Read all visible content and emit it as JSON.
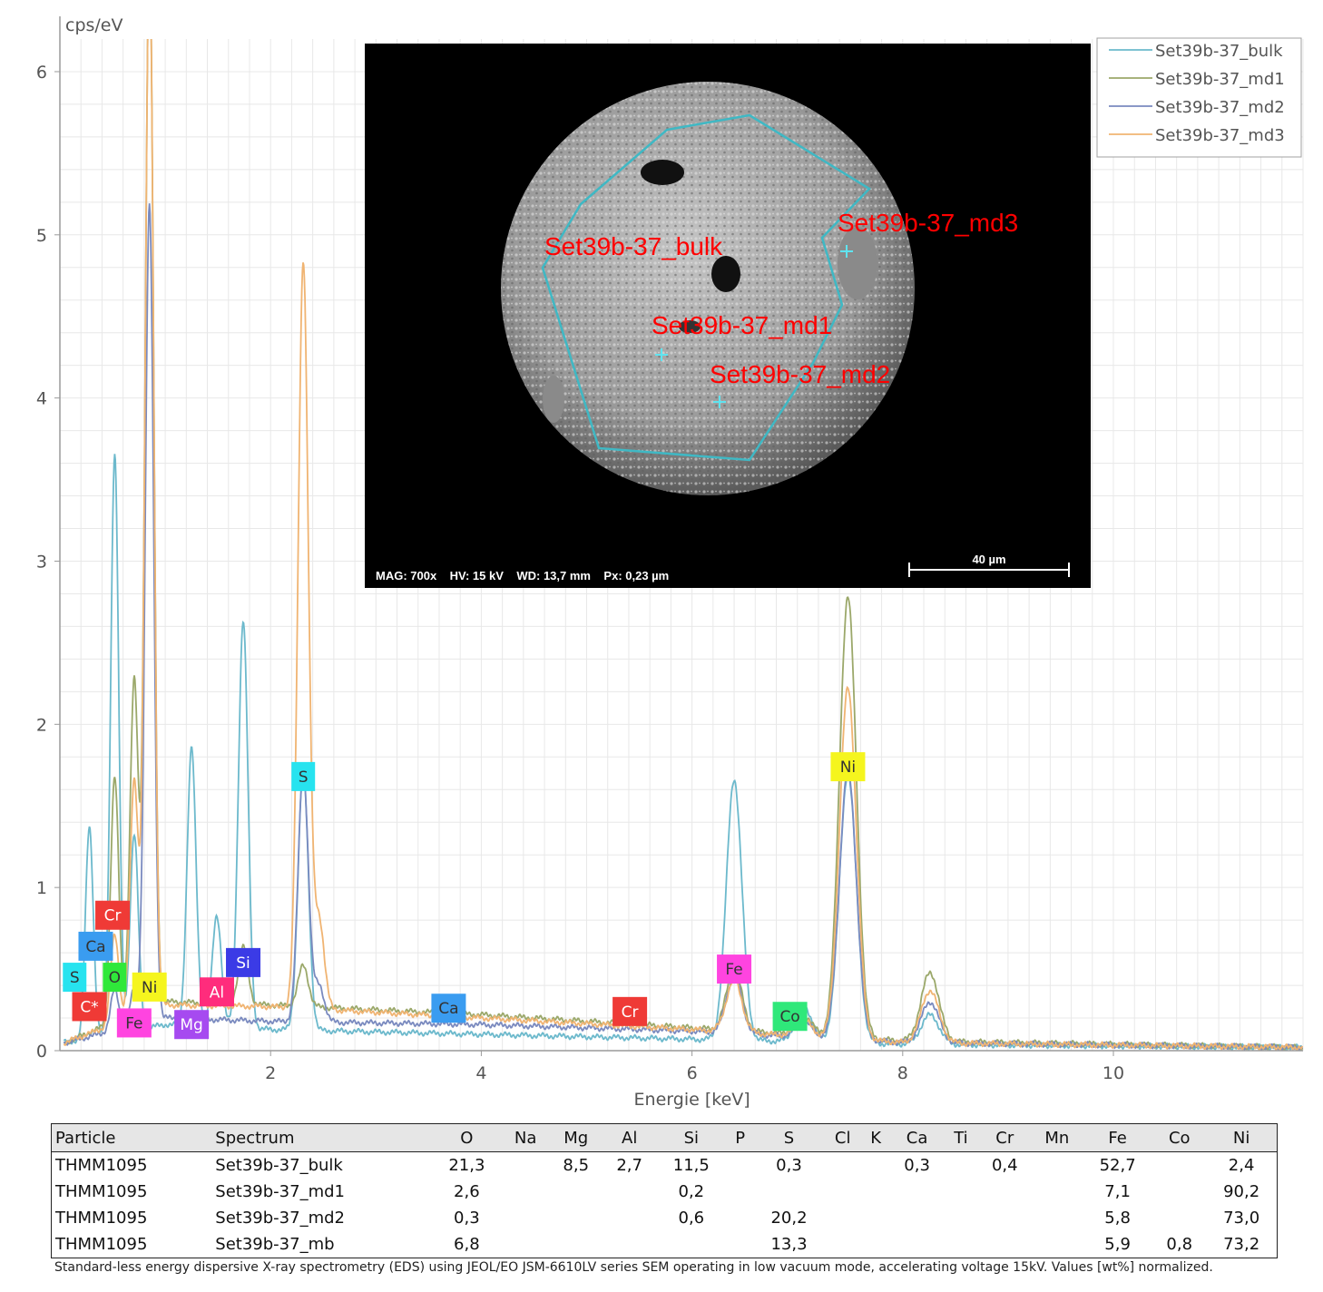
{
  "chart_data": {
    "type": "line",
    "ylabel": "cps/eV",
    "xlabel": "Energie [keV]",
    "xlim": [
      0,
      11.8
    ],
    "ylim": [
      0,
      6.2
    ],
    "xticks": [
      2,
      4,
      6,
      8,
      10
    ],
    "yticks": [
      0,
      1,
      2,
      3,
      4,
      5,
      6
    ],
    "grid": true,
    "legend_position": "top-right",
    "series": [
      {
        "name": "Set39b-37_bulk",
        "color": "#6cb9cc",
        "peaks": [
          [
            0.28,
            1.3
          ],
          [
            0.52,
            3.55
          ],
          [
            0.705,
            1.2
          ],
          [
            1.25,
            1.7
          ],
          [
            1.49,
            0.68
          ],
          [
            1.74,
            2.5
          ],
          [
            2.31,
            1.6
          ],
          [
            6.4,
            1.6
          ],
          [
            7.06,
            0.22
          ],
          [
            7.48,
            1.65
          ],
          [
            8.26,
            0.18
          ]
        ],
        "baseline": [
          [
            0.05,
            0.05
          ],
          [
            1,
            0.16
          ],
          [
            2,
            0.13
          ],
          [
            4,
            0.1
          ],
          [
            6,
            0.07
          ],
          [
            8,
            0.04
          ],
          [
            11.8,
            0.02
          ]
        ]
      },
      {
        "name": "Set39b-37_md1",
        "color": "#9ba86a",
        "peaks": [
          [
            0.52,
            1.5
          ],
          [
            0.705,
            2.05
          ],
          [
            0.85,
            6.5
          ],
          [
            1.74,
            0.35
          ],
          [
            2.31,
            0.25
          ],
          [
            6.4,
            0.38
          ],
          [
            7.06,
            0.12
          ],
          [
            7.48,
            2.7
          ],
          [
            8.26,
            0.42
          ]
        ],
        "baseline": [
          [
            0.05,
            0.05
          ],
          [
            1,
            0.3
          ],
          [
            2,
            0.28
          ],
          [
            4,
            0.22
          ],
          [
            6,
            0.14
          ],
          [
            8,
            0.06
          ],
          [
            11.8,
            0.02
          ]
        ]
      },
      {
        "name": "Set39b-37_md2",
        "color": "#7a8abf",
        "peaks": [
          [
            0.52,
            0.25
          ],
          [
            0.705,
            0.22
          ],
          [
            0.85,
            5.0
          ],
          [
            2.31,
            1.55
          ],
          [
            2.46,
            0.22
          ],
          [
            6.4,
            0.35
          ],
          [
            7.06,
            0.1
          ],
          [
            7.48,
            1.65
          ],
          [
            8.26,
            0.25
          ]
        ],
        "baseline": [
          [
            0.05,
            0.05
          ],
          [
            1,
            0.2
          ],
          [
            2,
            0.18
          ],
          [
            4,
            0.16
          ],
          [
            6,
            0.12
          ],
          [
            8,
            0.05
          ],
          [
            11.8,
            0.02
          ]
        ]
      },
      {
        "name": "Set39b-37_md3",
        "color": "#f0b472",
        "peaks": [
          [
            0.52,
            0.55
          ],
          [
            0.705,
            1.45
          ],
          [
            0.85,
            6.5
          ],
          [
            2.31,
            4.58
          ],
          [
            2.46,
            0.55
          ],
          [
            6.4,
            0.32
          ],
          [
            7.06,
            0.1
          ],
          [
            7.48,
            2.15
          ],
          [
            8.26,
            0.32
          ]
        ],
        "baseline": [
          [
            0.05,
            0.05
          ],
          [
            1,
            0.28
          ],
          [
            2,
            0.27
          ],
          [
            4,
            0.2
          ],
          [
            6,
            0.13
          ],
          [
            8,
            0.05
          ],
          [
            11.8,
            0.02
          ]
        ]
      }
    ],
    "element_labels": [
      {
        "label": "S",
        "color": "#27e3ef",
        "x": 2.31,
        "y": 1.68
      },
      {
        "label": "Ni",
        "color": "#f5f51e",
        "x": 7.48,
        "y": 1.74
      },
      {
        "label": "Fe",
        "color": "#ff44e0",
        "x": 6.4,
        "y": 0.5
      },
      {
        "label": "Co",
        "color": "#2fe87a",
        "x": 6.93,
        "y": 0.21
      },
      {
        "label": "Cr",
        "color": "#ef3a36",
        "x": 5.41,
        "y": 0.24
      },
      {
        "label": "Ca",
        "color": "#3a9cf0",
        "x": 3.69,
        "y": 0.26
      },
      {
        "label": "Si",
        "color": "#3b3be6",
        "x": 1.74,
        "y": 0.54
      },
      {
        "label": "Al",
        "color": "#ff2c7c",
        "x": 1.49,
        "y": 0.36
      },
      {
        "label": "Mg",
        "color": "#a64af0",
        "x": 1.25,
        "y": 0.16
      },
      {
        "label": "Ni",
        "color": "#f5f51e",
        "x": 0.85,
        "y": 0.39
      },
      {
        "label": "Fe",
        "color": "#ff44e0",
        "x": 0.705,
        "y": 0.17
      },
      {
        "label": "O",
        "color": "#2fe83a",
        "x": 0.52,
        "y": 0.45
      },
      {
        "label": "S",
        "color": "#27e3ef",
        "x": 0.14,
        "y": 0.45
      },
      {
        "label": "Ca",
        "color": "#3a9cf0",
        "x": 0.34,
        "y": 0.64
      },
      {
        "label": "Cr",
        "color": "#ef3a36",
        "x": 0.5,
        "y": 0.83
      },
      {
        "label": "C*",
        "color": "#ef3a36",
        "x": 0.28,
        "y": 0.27
      }
    ]
  },
  "sem_image": {
    "point_labels": [
      "Set39b-37_bulk",
      "Set39b-37_md1",
      "Set39b-37_md2",
      "Set39b-37_md3"
    ],
    "info": "MAG: 700x    HV: 15 kV    WD: 13,7 mm    Px: 0,23 µm",
    "scale_bar": "40 µm"
  },
  "table": {
    "headers": [
      "Particle",
      "Spectrum",
      "O",
      "Na",
      "Mg",
      "Al",
      "Si",
      "P",
      "S",
      "Cl",
      "K",
      "Ca",
      "Ti",
      "Cr",
      "Mn",
      "Fe",
      "Co",
      "Ni"
    ],
    "rows": [
      [
        "THMM1095",
        "Set39b-37_bulk",
        "21,3",
        "",
        "8,5",
        "2,7",
        "11,5",
        "",
        "0,3",
        "",
        "",
        "0,3",
        "",
        "0,4",
        "",
        "52,7",
        "",
        "2,4"
      ],
      [
        "THMM1095",
        "Set39b-37_md1",
        "2,6",
        "",
        "",
        "",
        "0,2",
        "",
        "",
        "",
        "",
        "",
        "",
        "",
        "",
        "7,1",
        "",
        "90,2"
      ],
      [
        "THMM1095",
        "Set39b-37_md2",
        "0,3",
        "",
        "",
        "",
        "0,6",
        "",
        "20,2",
        "",
        "",
        "",
        "",
        "",
        "",
        "5,8",
        "",
        "73,0"
      ],
      [
        "THMM1095",
        "Set39b-37_mb",
        "6,8",
        "",
        "",
        "",
        "",
        "",
        "13,3",
        "",
        "",
        "",
        "",
        "",
        "",
        "5,9",
        "0,8",
        "73,2"
      ]
    ]
  },
  "footnote": "Standard-less energy dispersive X-ray spectrometry (EDS) using JEOL/EO JSM-6610LV series SEM operating in low vacuum mode, accelerating voltage 15kV. Values [wt%] normalized."
}
